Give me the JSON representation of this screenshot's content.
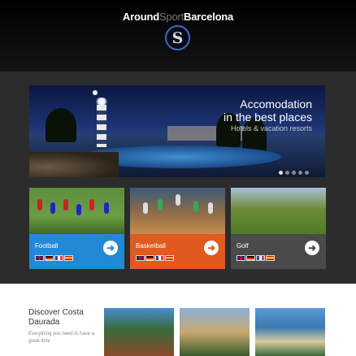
{
  "header": {
    "brand_part1": "Around",
    "brand_part2": "Sport",
    "brand_part3": "Barcelona",
    "logo_letter": "S"
  },
  "hero": {
    "title_line1": "Accomodation",
    "title_line2": "in the best places",
    "subtitle": "Hotels & vacation resorts",
    "slide_count": 5,
    "active_slide": 1
  },
  "cards": [
    {
      "label": "Football",
      "color": "#2389d6",
      "flags": [
        "uk-flag",
        "de-flag",
        "fr-flag",
        "es-flag"
      ]
    },
    {
      "label": "Basketball",
      "color": "#e05a1e",
      "flags": [
        "uk-flag",
        "de-flag",
        "fr-flag",
        "es-flag"
      ]
    },
    {
      "label": "Golf",
      "color": "#4a4a4a",
      "flags": [
        "uk-flag",
        "de-flag",
        "fr-flag",
        "es-flag"
      ]
    }
  ],
  "discover": {
    "title": "Discover Costa Daurada",
    "subtitle": "Everything you need to have a great time"
  }
}
